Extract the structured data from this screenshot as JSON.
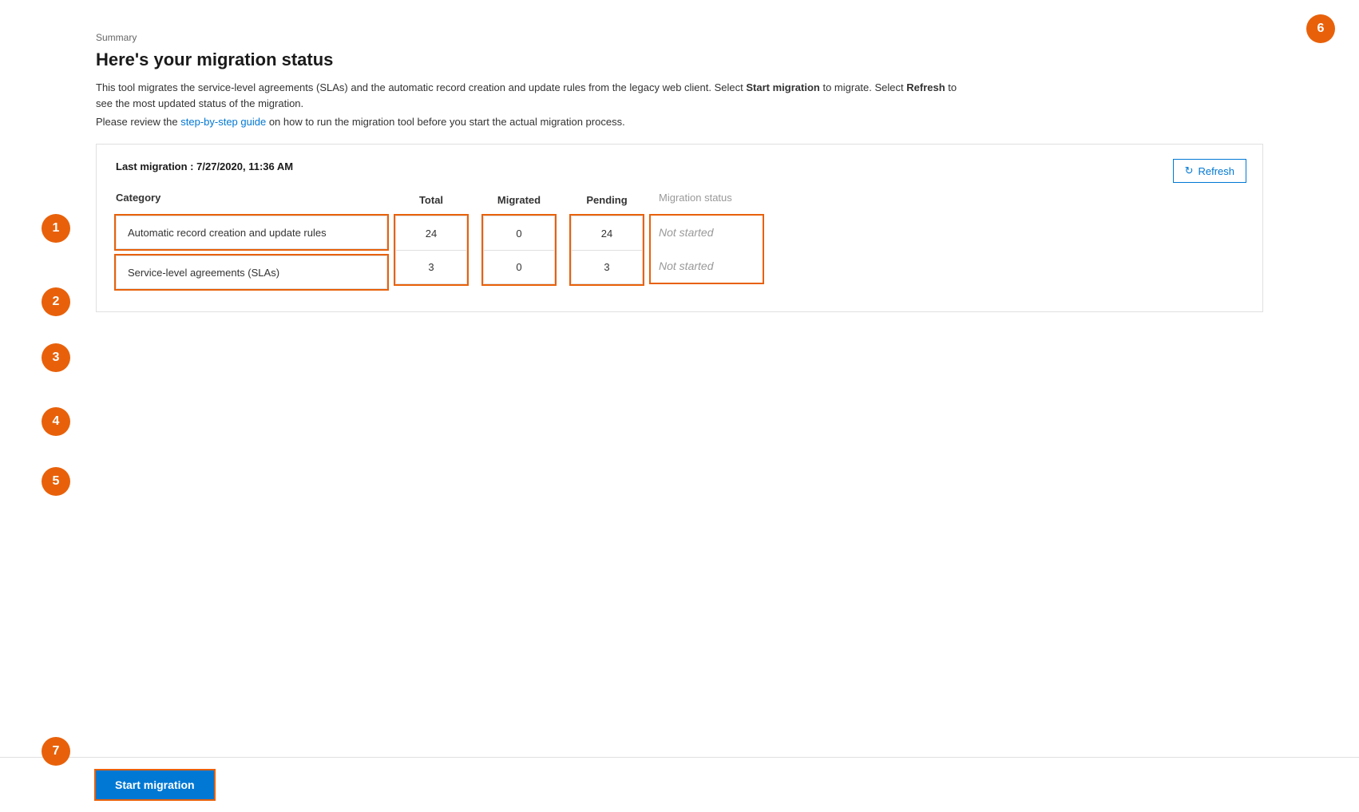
{
  "breadcrumb": "Summary",
  "title": "Here's your migration status",
  "description": "This tool migrates the service-level agreements (SLAs) and the automatic record creation and update rules from the legacy web client. Select",
  "desc_bold1": "Start migration",
  "desc_mid": "to migrate. Select",
  "desc_bold2": "Refresh",
  "desc_end": "to see the most updated status of the migration.",
  "guide_prefix": "Please review the",
  "guide_link_text": "step-by-step guide",
  "guide_suffix": "on how to run the migration tool before you start the actual migration process.",
  "last_migration_label": "Last migration :",
  "last_migration_value": "7/27/2020, 11:36 AM",
  "refresh_button": "Refresh",
  "table": {
    "col_category": "Category",
    "col_total": "Total",
    "col_migrated": "Migrated",
    "col_pending": "Pending",
    "col_status": "Migration status",
    "rows": [
      {
        "category": "Automatic record creation and update rules",
        "total": "24",
        "migrated": "0",
        "pending": "24",
        "status": "Not started"
      },
      {
        "category": "Service-level agreements (SLAs)",
        "total": "3",
        "migrated": "0",
        "pending": "3",
        "status": "Not started"
      }
    ]
  },
  "start_button": "Start migration",
  "annotations": [
    {
      "number": "1",
      "top": "268",
      "left": "52"
    },
    {
      "number": "2",
      "top": "360",
      "left": "52"
    },
    {
      "number": "3",
      "top": "430",
      "left": "52"
    },
    {
      "number": "4",
      "top": "510",
      "left": "52"
    },
    {
      "number": "5",
      "top": "585",
      "left": "52"
    },
    {
      "number": "6",
      "top": "18",
      "left": "1640"
    },
    {
      "number": "7",
      "top": "940",
      "left": "52"
    }
  ]
}
